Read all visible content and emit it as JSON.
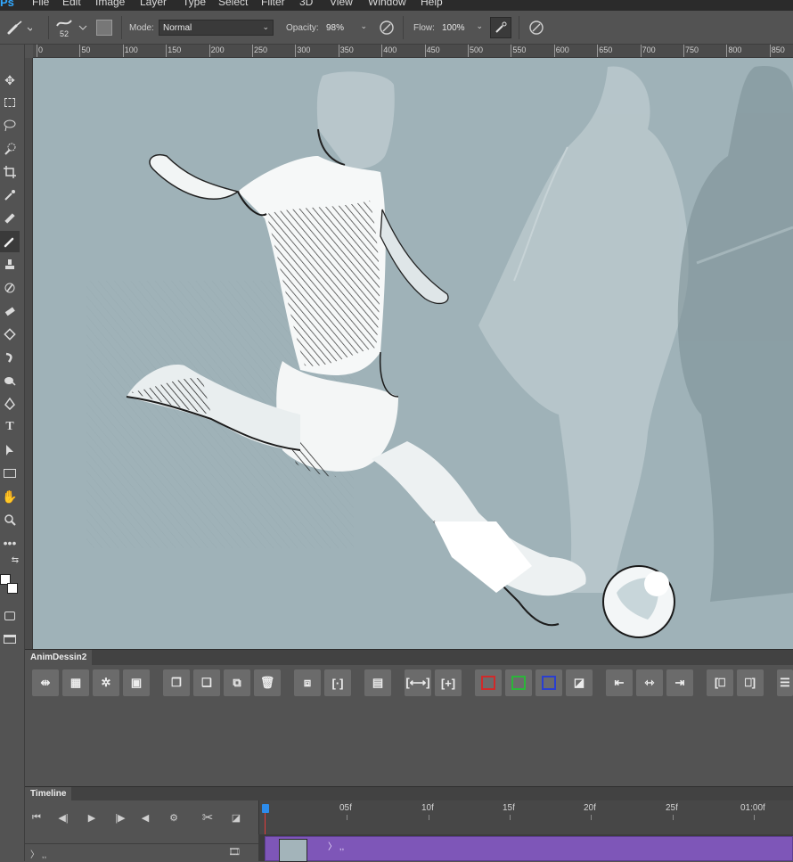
{
  "app": {
    "logo": "Ps"
  },
  "menu": [
    "File",
    "Edit",
    "Image",
    "Layer",
    "Type",
    "Select",
    "Filter",
    "3D",
    "View",
    "Window",
    "Help"
  ],
  "options": {
    "brush_size": "52",
    "mode_label": "Mode:",
    "mode_value": "Normal",
    "opacity_label": "Opacity:",
    "opacity_value": "98%",
    "flow_label": "Flow:",
    "flow_value": "100%"
  },
  "ruler": {
    "labels": [
      "0",
      "50",
      "100",
      "150",
      "200",
      "250",
      "300",
      "350",
      "400",
      "450",
      "500",
      "550",
      "600",
      "650",
      "700",
      "750",
      "800",
      "850"
    ]
  },
  "anim_panel": {
    "tab_title": "AnimDessin2"
  },
  "timeline": {
    "tab_title": "Timeline",
    "frames": [
      "05f",
      "10f",
      "15f",
      "20f",
      "25f",
      "01:00f"
    ],
    "clip_label": "〉 ,,",
    "track_label": "〉 ,,"
  },
  "colors": {
    "accent": "#31a8ff",
    "clip": "#7e56b8",
    "canvas_bg": "#9fb2b8",
    "ui_bg": "#535353"
  }
}
